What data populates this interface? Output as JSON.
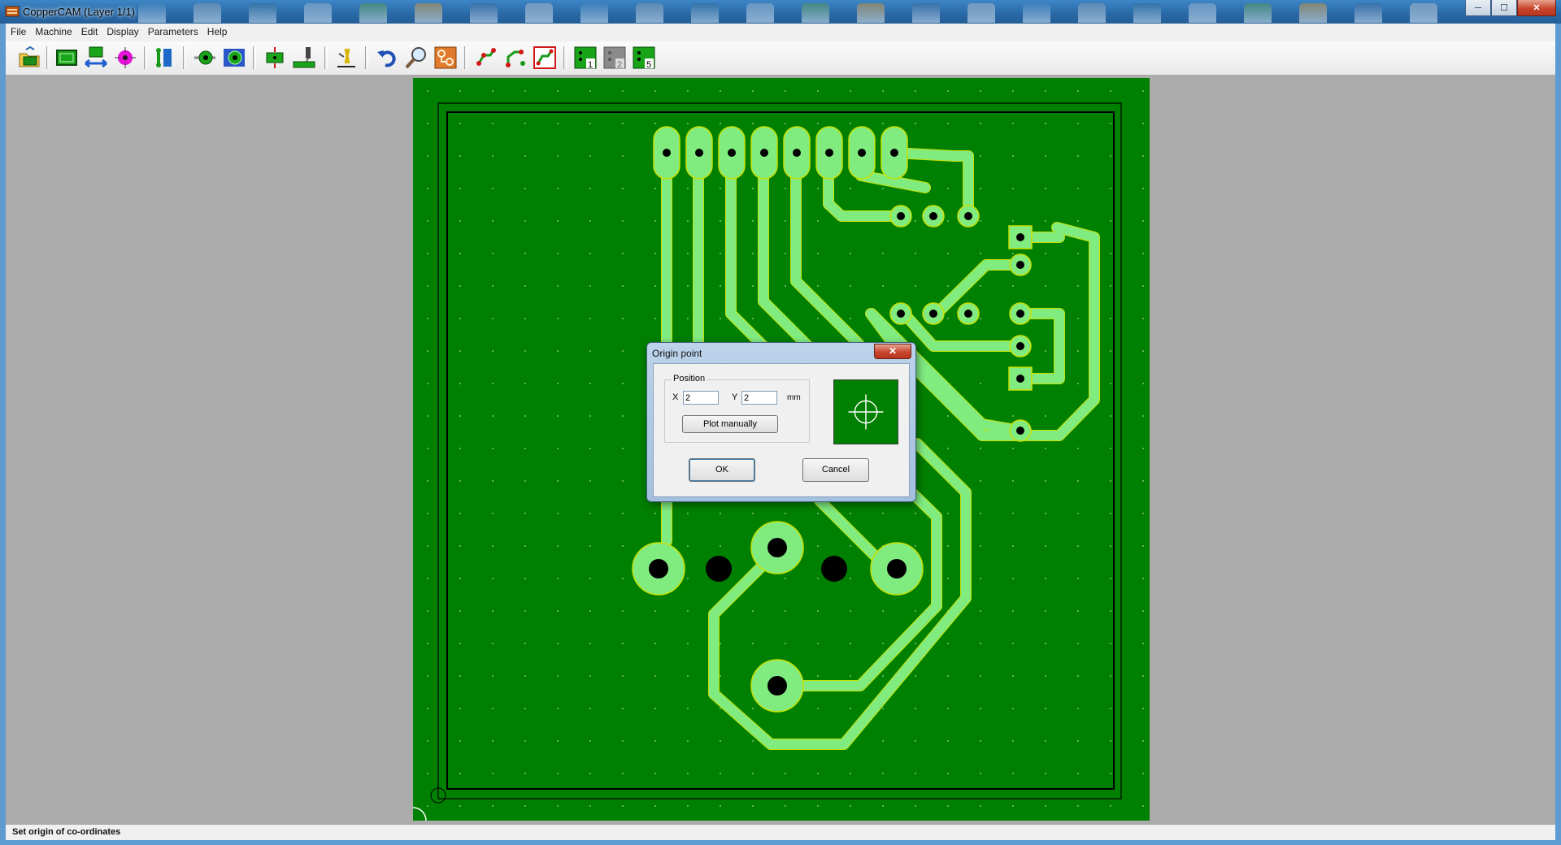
{
  "window": {
    "title": "CopperCAM  (Layer 1/1)",
    "controls": {
      "minimize": "─",
      "maximize": "☐",
      "close": "✕"
    }
  },
  "menu": [
    "File",
    "Machine",
    "Edit",
    "Display",
    "Parameters",
    "Help"
  ],
  "toolbar": {
    "buttons": [
      "open-folder-icon",
      "board-contour-icon",
      "mirror-board-icon",
      "drill-point-icon",
      "track-select-icon",
      "pad-select-icon",
      "isolation-paths-icon",
      "drill-holes-icon",
      "milling-tool-icon",
      "engraving-tool-icon",
      "undo-icon",
      "zoom-icon",
      "board-view-icon",
      "traces-red-icon",
      "traces-select-icon",
      "traces-frame-icon",
      "layer-1-icon",
      "layer-2-icon",
      "layer-5-icon"
    ],
    "layer_badges": {
      "one": "1",
      "two": "2",
      "five": "5"
    }
  },
  "dialog": {
    "title": "Origin point",
    "close_glyph": "✕",
    "group_label": "Position",
    "x_label": "X",
    "x_value": "2",
    "y_label": "Y",
    "y_value": "2",
    "unit": "mm",
    "plot_button": "Plot manually",
    "ok_button": "OK",
    "cancel_button": "Cancel"
  },
  "status": {
    "text": "Set origin of co-ordinates"
  },
  "colors": {
    "board_background": "#008000",
    "track": "#7fee7f",
    "track_outline": "#c8e000",
    "hole": "#000000",
    "workspace": "#ababab"
  }
}
